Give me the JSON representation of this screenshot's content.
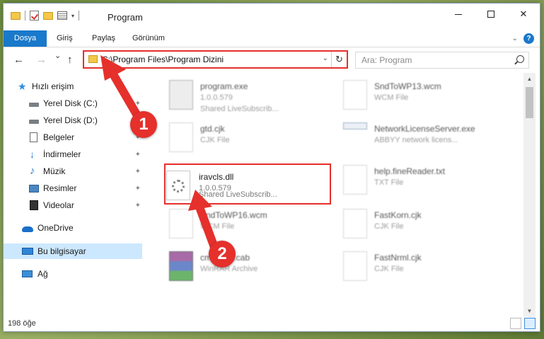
{
  "window": {
    "title": "Program",
    "minimize_glyph": "",
    "maximize_glyph": "",
    "close_glyph": "✕"
  },
  "ribbon": {
    "tabs": [
      "Dosya",
      "Giriş",
      "Paylaş",
      "Görünüm"
    ],
    "help_label": "?"
  },
  "navbar": {
    "back": "←",
    "forward": "→",
    "recent": "⌄",
    "up": "↑",
    "address": "C:\\Program Files\\Program Dizini",
    "refresh": "↻",
    "search_placeholder": "Ara: Program"
  },
  "sidebar": {
    "items": [
      {
        "label": "Hızlı erişim",
        "icon": "star-icon"
      },
      {
        "label": "Yerel Disk (C:)",
        "icon": "drive-icon"
      },
      {
        "label": "Yerel Disk (D:)",
        "icon": "drive-icon"
      },
      {
        "label": "Belgeler",
        "icon": "documents-icon"
      },
      {
        "label": "İndirmeler",
        "icon": "downloads-icon"
      },
      {
        "label": "Müzik",
        "icon": "music-icon"
      },
      {
        "label": "Resimler",
        "icon": "pictures-icon"
      },
      {
        "label": "Videolar",
        "icon": "videos-icon"
      },
      {
        "label": "OneDrive",
        "icon": "cloud-icon"
      },
      {
        "label": "Bu bilgisayar",
        "icon": "computer-icon"
      },
      {
        "label": "Ağ",
        "icon": "network-icon"
      }
    ],
    "pin_glyph": "📌"
  },
  "files": [
    {
      "name": "program.exe",
      "line2": "1.0.0.579",
      "line3": "Shared LiveSubscrib..."
    },
    {
      "name": "SndToWP13.wcm",
      "line2": "WCM File",
      "line3": ""
    },
    {
      "name": "gtd.cjk",
      "line2": "CJK File",
      "line3": ""
    },
    {
      "name": "NetworkLicenseServer.exe",
      "line2": "ABBYY network licens...",
      "line3": ""
    },
    {
      "name": "iravcls.dll",
      "line2": "1.0.0.579",
      "line3": "Shared LiveSubscrib..."
    },
    {
      "name": "help.fineReader.txt",
      "line2": "TXT File",
      "line3": ""
    },
    {
      "name": "SndToWP16.wcm",
      "line2": "WCM File",
      "line3": ""
    },
    {
      "name": "FastKorn.cjk",
      "line2": "CJK File",
      "line3": ""
    },
    {
      "name": "cmdlines.cab",
      "line2": "WinRAR Archive",
      "line3": ""
    },
    {
      "name": "FastNrml.cjk",
      "line2": "CJK File",
      "line3": ""
    }
  ],
  "status": {
    "item_count": "198 öğe"
  },
  "annotations": {
    "badge_1": "1",
    "badge_2": "2",
    "color": "#e5302c"
  }
}
